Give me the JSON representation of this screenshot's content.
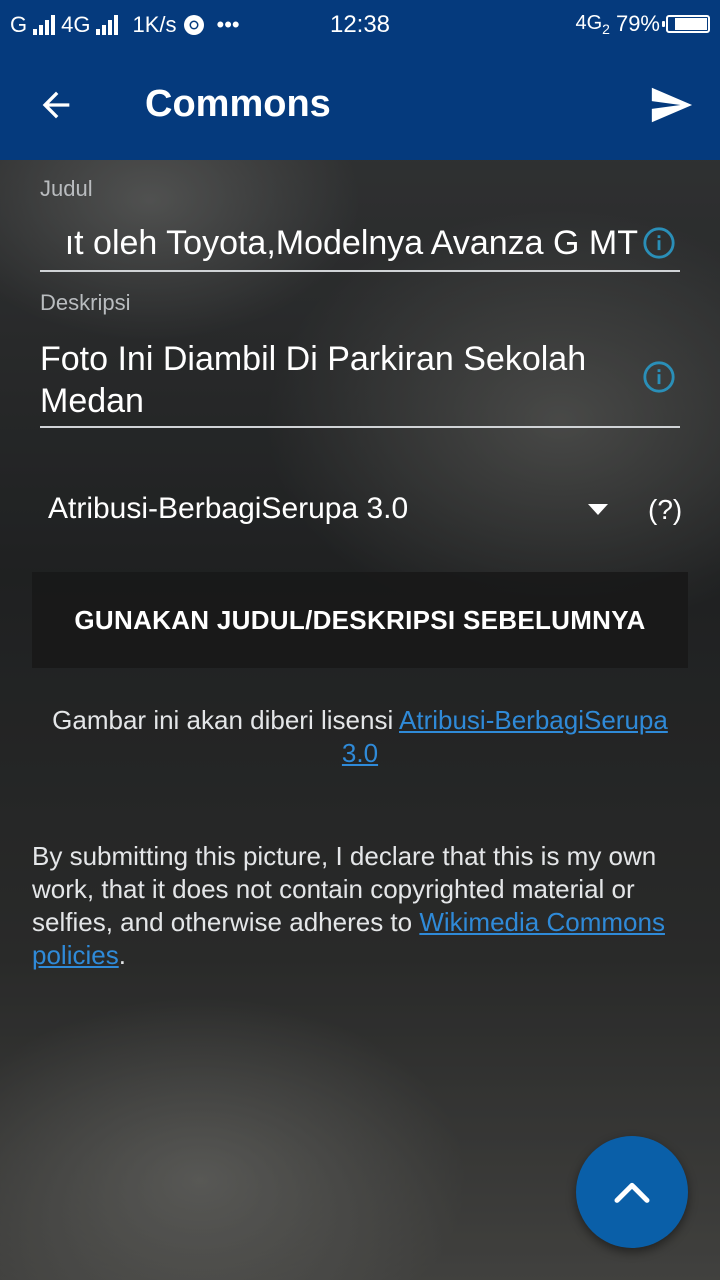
{
  "status_bar": {
    "carrier1": "G",
    "carrier2": "4G",
    "speed": "1K/s",
    "more": "•••",
    "time": "12:38",
    "network_right": "4G",
    "sim_index": "2",
    "battery": "79%",
    "battery_level": 0.79
  },
  "app_bar": {
    "title": "Commons",
    "back_icon": "arrow-left-icon",
    "send_icon": "send-icon"
  },
  "form": {
    "title_label": "Judul",
    "title_value": "Foto Ini Diambil Oleh Toyota,Modelnya Avanza G MT",
    "title_visible": "ıt oleh Toyota,Modelnya Avanza G MT",
    "description_label": "Deskripsi",
    "description_value": "Foto Ini Diambil Di Parkiran Sekolah Medan",
    "license_selected": "Atribusi-BerbagiSerupa 3.0",
    "license_help": "(?)",
    "previous_button": "GUNAKAN JUDUL/DESKRIPSI SEBELUMNYA"
  },
  "license_note": {
    "prefix": "Gambar ini akan diberi lisensi ",
    "link": "Atribusi-BerbagiSerupa 3.0"
  },
  "declaration": {
    "text": "By submitting this picture, I declare that this is my own work, that it does not contain copyrighted material or selfies, and otherwise adheres to ",
    "link": "Wikimedia Commons policies",
    "suffix": "."
  },
  "fab": {
    "icon": "chevron-up-icon"
  },
  "colors": {
    "primary": "#053a7d",
    "link": "#2f8ad8",
    "fab": "#0a5fa8",
    "info_icon": "#2a8fb8"
  }
}
